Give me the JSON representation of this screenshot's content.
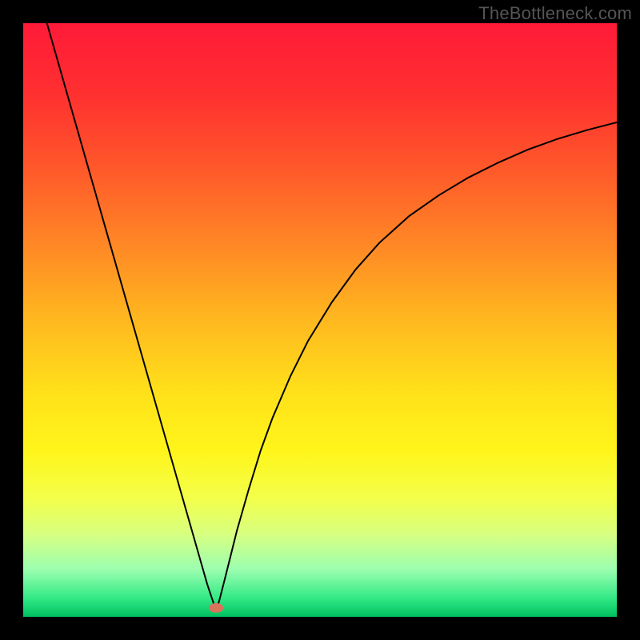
{
  "watermark": "TheBottleneck.com",
  "chart_data": {
    "type": "line",
    "title": "",
    "xlabel": "",
    "ylabel": "",
    "xlim": [
      0,
      100
    ],
    "ylim": [
      0,
      100
    ],
    "grid": false,
    "legend": false,
    "background_gradient": {
      "stops": [
        {
          "offset": 0.0,
          "color": "#ff1a38"
        },
        {
          "offset": 0.12,
          "color": "#ff3030"
        },
        {
          "offset": 0.25,
          "color": "#ff5a2a"
        },
        {
          "offset": 0.38,
          "color": "#ff8a25"
        },
        {
          "offset": 0.5,
          "color": "#ffb81f"
        },
        {
          "offset": 0.62,
          "color": "#ffe01a"
        },
        {
          "offset": 0.72,
          "color": "#fff51a"
        },
        {
          "offset": 0.8,
          "color": "#f3ff4a"
        },
        {
          "offset": 0.86,
          "color": "#d8ff80"
        },
        {
          "offset": 0.92,
          "color": "#9cffb0"
        },
        {
          "offset": 0.97,
          "color": "#30e884"
        },
        {
          "offset": 1.0,
          "color": "#00c060"
        }
      ]
    },
    "minimum_marker": {
      "x": 32.5,
      "y": 1.5,
      "color": "#d9745c"
    },
    "series": [
      {
        "name": "curve",
        "color": "#000000",
        "width": 2,
        "x": [
          4,
          6,
          8,
          10,
          12,
          14,
          16,
          18,
          20,
          22,
          24,
          26,
          28,
          30,
          31,
          32,
          32.5,
          33,
          34,
          35,
          36,
          38,
          40,
          42,
          45,
          48,
          52,
          56,
          60,
          65,
          70,
          75,
          80,
          85,
          90,
          95,
          100
        ],
        "y": [
          100,
          93,
          86,
          79,
          72,
          65,
          58,
          51,
          44,
          37,
          30,
          23,
          16,
          9,
          5.5,
          2.5,
          1.2,
          2.6,
          6.5,
          10.5,
          14.5,
          21.5,
          28,
          33.5,
          40.5,
          46.5,
          53,
          58.5,
          63,
          67.5,
          71,
          74,
          76.5,
          78.7,
          80.5,
          82,
          83.3
        ]
      }
    ]
  }
}
